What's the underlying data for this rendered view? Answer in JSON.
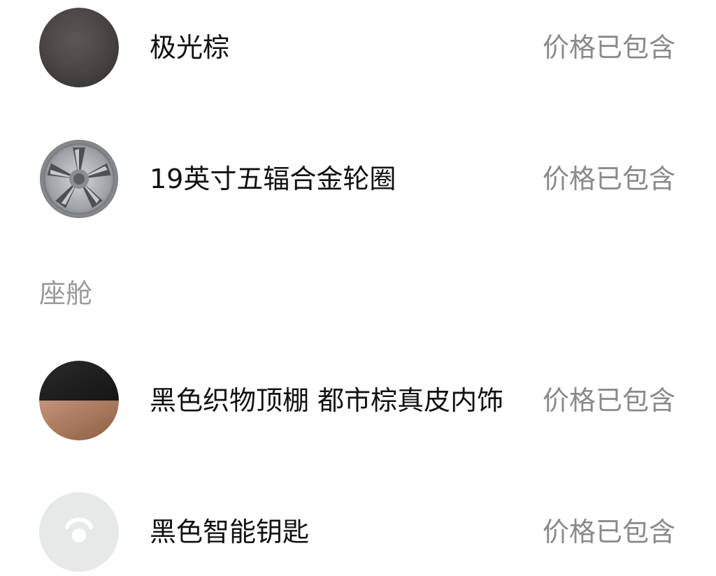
{
  "items": [
    {
      "name": "极光棕",
      "price": "价格已包含",
      "thumb": "paint-swatch-icon",
      "swatch_colors": [
        "#4a4644",
        "#5d5855",
        "#3a3735"
      ]
    },
    {
      "name": "19英寸五辐合金轮圈",
      "price": "价格已包含",
      "thumb": "alloy-wheel-icon",
      "wheel_colors": [
        "#8d9094",
        "#c9cbcd",
        "#5b5e62"
      ]
    },
    {
      "name": "黑色织物顶棚 都市棕真皮内饰",
      "price": "价格已包含",
      "thumb": "interior-swatch-icon",
      "swatch_colors": [
        "#1e1e1e",
        "#a8785d"
      ]
    },
    {
      "name": "黑色智能钥匙",
      "price": "价格已包含",
      "thumb": "smart-key-icon",
      "swatch_colors": [
        "#e6e9e8",
        "#ffffff"
      ]
    }
  ],
  "section": {
    "title": "座舱"
  },
  "colors": {
    "background": "#ffffff",
    "text_primary": "#111111",
    "text_secondary": "#8a8a8a",
    "section_title": "#9a9a9a"
  }
}
